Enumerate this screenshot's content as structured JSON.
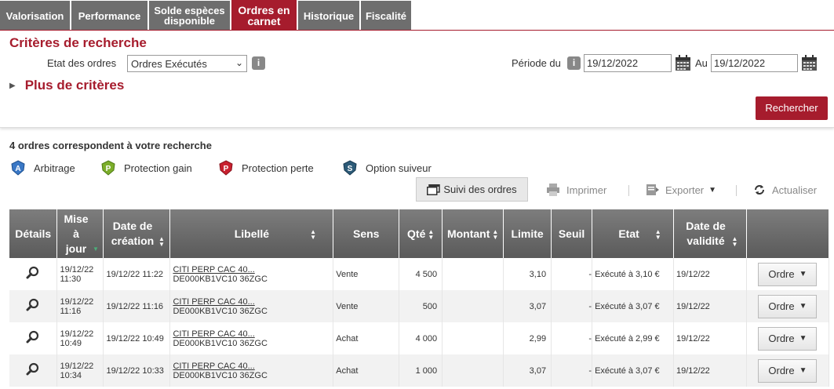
{
  "tabs": [
    {
      "label": "Valorisation",
      "active": false
    },
    {
      "label": "Performance",
      "active": false
    },
    {
      "label": "Solde espèces disponible",
      "active": false
    },
    {
      "label": "Ordres en carnet",
      "active": true
    },
    {
      "label": "Historique",
      "active": false
    },
    {
      "label": "Fiscalité",
      "active": false
    }
  ],
  "search": {
    "title": "Critères de recherche",
    "etat_label": "Etat des ordres",
    "etat_value": "Ordres Exécutés",
    "periode_label": "Période du",
    "date_from": "19/12/2022",
    "au_label": "Au",
    "date_to": "19/12/2022",
    "more_label": "Plus de critères",
    "search_button": "Rechercher"
  },
  "results": {
    "count_text": "4 ordres correspondent à votre recherche",
    "legend": [
      {
        "letter": "A",
        "label": "Arbitrage",
        "color": "#3a78c6"
      },
      {
        "letter": "P",
        "label": "Protection gain",
        "color": "#7cae2a"
      },
      {
        "letter": "P",
        "label": "Protection perte",
        "color": "#c8202f"
      },
      {
        "letter": "S",
        "label": "Option suiveur",
        "color": "#2d5b78"
      }
    ],
    "toolbar": {
      "suivi": "Suivi des ordres",
      "imprimer": "Imprimer",
      "exporter": "Exporter",
      "actualiser": "Actualiser"
    }
  },
  "table": {
    "headers": {
      "details": "Détails",
      "mise_a_jour": "Mise à jour",
      "date_creation": "Date de création",
      "libelle": "Libellé",
      "sens": "Sens",
      "qte": "Qté",
      "montant": "Montant",
      "limite": "Limite",
      "seuil": "Seuil",
      "etat": "Etat",
      "date_validite": "Date de validité"
    },
    "rows": [
      {
        "maj_date": "19/12/22",
        "maj_time": "11:30",
        "creation": "19/12/22 11:22",
        "libelle": "CITI PERP CAC 40...",
        "code": "DE000KB1VC10 36ZGC",
        "sens": "Vente",
        "qte": "4 500",
        "montant": "",
        "limite": "3,10",
        "seuil": "-",
        "etat": "Exécuté à 3,10 €",
        "validite": "19/12/22",
        "action": "Ordre"
      },
      {
        "maj_date": "19/12/22",
        "maj_time": "11:16",
        "creation": "19/12/22 11:16",
        "libelle": "CITI PERP CAC 40...",
        "code": "DE000KB1VC10 36ZGC",
        "sens": "Vente",
        "qte": "500",
        "montant": "",
        "limite": "3,07",
        "seuil": "-",
        "etat": "Exécuté à 3,07 €",
        "validite": "19/12/22",
        "action": "Ordre"
      },
      {
        "maj_date": "19/12/22",
        "maj_time": "10:49",
        "creation": "19/12/22 10:49",
        "libelle": "CITI PERP CAC 40...",
        "code": "DE000KB1VC10 36ZGC",
        "sens": "Achat",
        "qte": "4 000",
        "montant": "",
        "limite": "2,99",
        "seuil": "-",
        "etat": "Exécuté à 2,99 €",
        "validite": "19/12/22",
        "action": "Ordre"
      },
      {
        "maj_date": "19/12/22",
        "maj_time": "10:34",
        "creation": "19/12/22 10:33",
        "libelle": "CITI PERP CAC 40...",
        "code": "DE000KB1VC10 36ZGC",
        "sens": "Achat",
        "qte": "1 000",
        "montant": "",
        "limite": "3,07",
        "seuil": "-",
        "etat": "Exécuté à 3,07 €",
        "validite": "19/12/22",
        "action": "Ordre"
      }
    ]
  }
}
